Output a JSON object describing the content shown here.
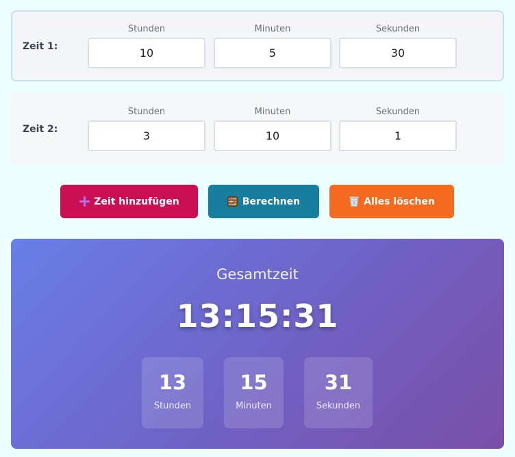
{
  "rows": [
    {
      "label": "Zeit 1:",
      "hours_label": "Stunden",
      "minutes_label": "Minuten",
      "seconds_label": "Sekunden",
      "hours": "10",
      "minutes": "5",
      "seconds": "30",
      "active": true
    },
    {
      "label": "Zeit 2:",
      "hours_label": "Stunden",
      "minutes_label": "Minuten",
      "seconds_label": "Sekunden",
      "hours": "3",
      "minutes": "10",
      "seconds": "1",
      "active": false
    }
  ],
  "actions": {
    "add_label": "Zeit hinzufügen",
    "add_icon": "plus-icon",
    "calculate_label": "Berechnen",
    "calculate_icon": "abacus-icon",
    "clear_label": "Alles löschen",
    "clear_icon": "wastebasket-icon"
  },
  "result": {
    "title": "Gesamtzeit",
    "total": "13:15:31",
    "hours": "13",
    "hours_label": "Stunden",
    "minutes": "15",
    "minutes_label": "Minuten",
    "seconds": "31",
    "seconds_label": "Sekunden"
  },
  "colors": {
    "add_button": "#cc0e52",
    "calculate_button": "#177e9f",
    "clear_button": "#f46a1e",
    "result_gradient_start": "#687ee8",
    "result_gradient_end": "#7a4ea8",
    "active_row_border": "#c5e1f4",
    "page_background": "#ecfefd"
  }
}
